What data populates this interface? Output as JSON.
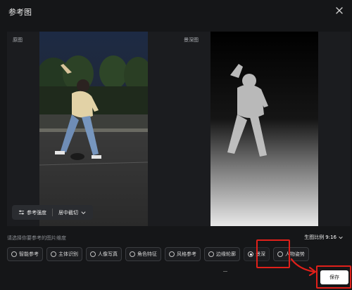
{
  "dialog": {
    "title": "参考图"
  },
  "preview": {
    "original_label": "原图",
    "depth_label": "景深图"
  },
  "toolbar": {
    "strength_label": "参考强度",
    "crop_label": "居中截切"
  },
  "settings": {
    "hint": "请选择你要参考的图片维度",
    "ratio_label": "生图比例",
    "ratio_value": "9:16"
  },
  "options": [
    {
      "label": "智能参考",
      "selected": false
    },
    {
      "label": "主体识别",
      "selected": false
    },
    {
      "label": "人像写真",
      "selected": false
    },
    {
      "label": "角色特征",
      "selected": false
    },
    {
      "label": "风格参考",
      "selected": false
    },
    {
      "label": "边缘轮廓",
      "selected": false
    },
    {
      "label": "景深",
      "selected": true
    },
    {
      "label": "人物姿势",
      "selected": false
    }
  ],
  "footer": {
    "save_label": "保存"
  },
  "colors": {
    "annotation_red": "#e0201a",
    "background": "#151618"
  }
}
